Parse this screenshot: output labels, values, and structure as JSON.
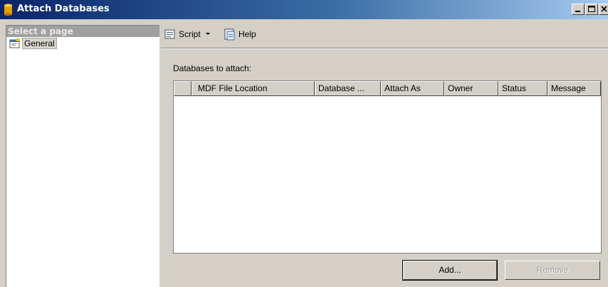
{
  "window": {
    "title": "Attach Databases",
    "controls": [
      "minimize-icon",
      "maximize-icon",
      "close-icon"
    ]
  },
  "sidebar": {
    "header": "Select a page",
    "items": [
      {
        "label": "General",
        "icon": "properties-page-icon",
        "selected": true
      }
    ]
  },
  "toolbar": {
    "script_label": "Script",
    "script_icon": "script-icon",
    "help_label": "Help",
    "help_icon": "help-icon"
  },
  "main": {
    "section_label": "Databases to attach:",
    "grid": {
      "columns": [
        "",
        "MDF File Location",
        "Database ...",
        "Attach As",
        "Owner",
        "Status",
        "Message"
      ],
      "rows": []
    },
    "add_label": "Add...",
    "remove_label": "Remove"
  },
  "colors": {
    "title_gradient_start": "#0a246a",
    "title_gradient_end": "#a6caf0",
    "window_background": "#d4d0c8",
    "disabled_text": "#a0a0a0"
  }
}
